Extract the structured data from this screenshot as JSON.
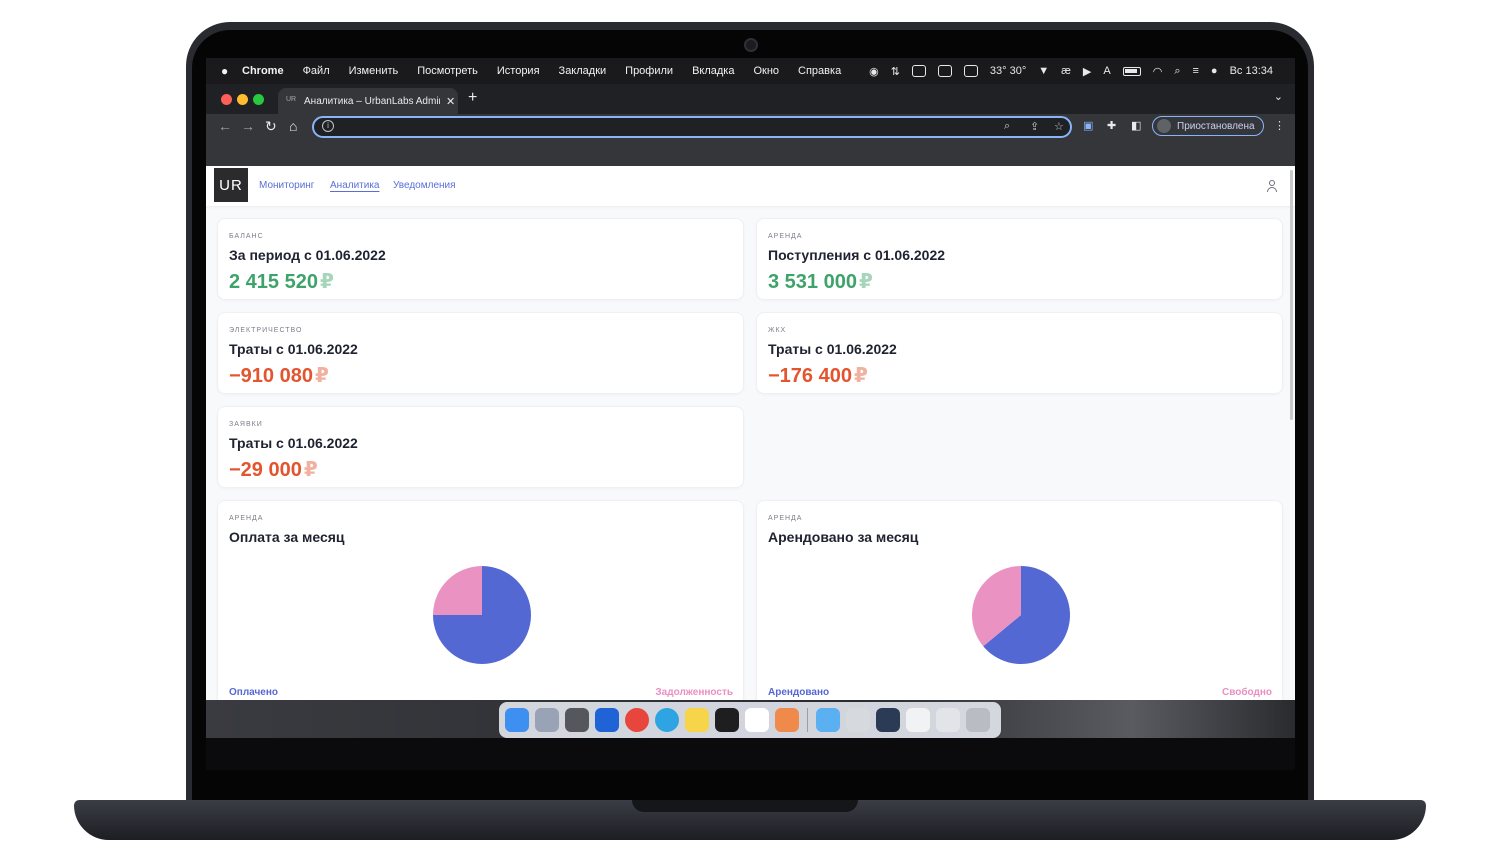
{
  "menubar": {
    "apple": "",
    "app_name": "Chrome",
    "items": [
      "Файл",
      "Изменить",
      "Посмотреть",
      "История",
      "Закладки",
      "Профили",
      "Вкладка",
      "Окно",
      "Справка"
    ],
    "weather": "33° 30°",
    "clock": "Вс 13:34"
  },
  "browser": {
    "tab_title": "Аналитика – UrbanLabs Admin",
    "tab_favicon": "UR",
    "address": "",
    "profile_label": "Приостановлена"
  },
  "app": {
    "logo": "UR",
    "nav": [
      {
        "label": "Мониторинг",
        "active": false
      },
      {
        "label": "Аналитика",
        "active": true
      },
      {
        "label": "Уведомления",
        "active": false
      }
    ]
  },
  "cards": [
    {
      "caption": "баланс",
      "title": "За период с 01.06.2022",
      "value": "2 415 520",
      "currency": "₽",
      "tone": "positive"
    },
    {
      "caption": "аренда",
      "title": "Поступления с 01.06.2022",
      "value": "3 531 000",
      "currency": "₽",
      "tone": "positive"
    },
    {
      "caption": "электричество",
      "title": "Траты с 01.06.2022",
      "value": "−910 080",
      "currency": "₽",
      "tone": "negative"
    },
    {
      "caption": "жкх",
      "title": "Траты с 01.06.2022",
      "value": "−176 400",
      "currency": "₽",
      "tone": "negative"
    },
    {
      "caption": "заявки",
      "title": "Траты с 01.06.2022",
      "value": "−29 000",
      "currency": "₽",
      "tone": "negative"
    }
  ],
  "chart_data": [
    {
      "type": "pie",
      "caption": "аренда",
      "title": "Оплата за месяц",
      "labels": [
        "Оплачено",
        "Задолженность"
      ],
      "values": [
        75,
        25
      ],
      "colors": [
        "#5468d4",
        "#ea93c3"
      ]
    },
    {
      "type": "pie",
      "caption": "аренда",
      "title": "Арендовано за месяц",
      "labels": [
        "Арендовано",
        "Свободно"
      ],
      "values": [
        64,
        36
      ],
      "colors": [
        "#5468d4",
        "#ea93c3"
      ]
    }
  ]
}
